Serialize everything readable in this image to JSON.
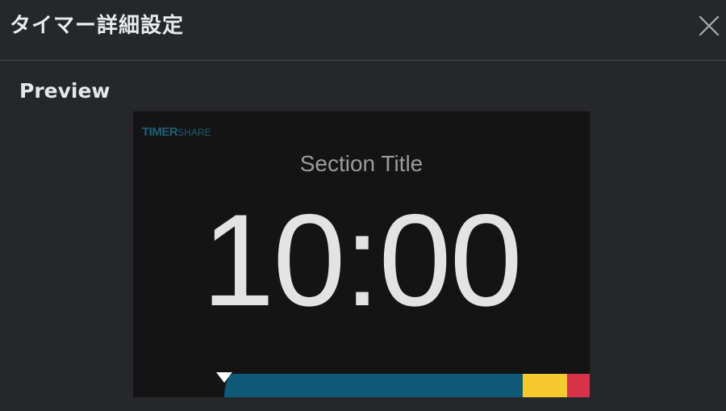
{
  "dialog": {
    "title": "タイマー詳細設定",
    "close_icon": "close-icon"
  },
  "preview": {
    "label": "Preview",
    "logo_strong": "TIMER",
    "logo_light": "SHARE",
    "section_title": "Section Title",
    "time": "10:00",
    "progress": {
      "elapsed_fraction": 0.2,
      "segments": [
        {
          "name": "normal",
          "color": "#0e5a78",
          "start_fraction": 0.2,
          "end_fraction": 0.853
        },
        {
          "name": "warning",
          "color": "#f6c92f",
          "start_fraction": 0.853,
          "end_fraction": 0.951
        },
        {
          "name": "danger",
          "color": "#d7324a",
          "start_fraction": 0.951,
          "end_fraction": 1.0
        }
      ]
    }
  }
}
